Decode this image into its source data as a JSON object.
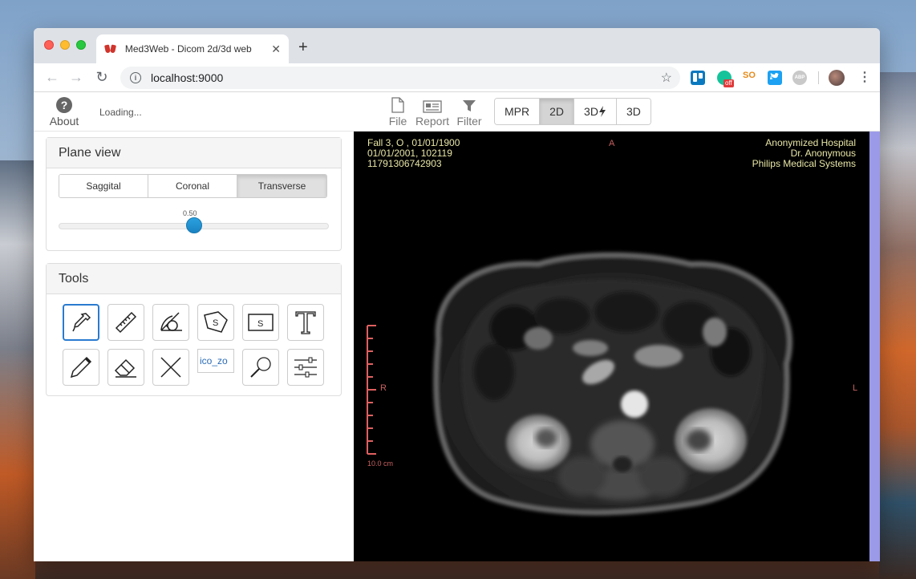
{
  "browser": {
    "tab_title": "Med3Web - Dicom 2d/3d web",
    "url": "localhost:9000",
    "extension_off_badge": "off",
    "extension_so": "SO",
    "extension_abp": "ABP"
  },
  "header": {
    "about_label": "About",
    "loading_text": "Loading...",
    "menu": {
      "file": "File",
      "report": "Report",
      "filter": "Filter"
    },
    "view_modes": [
      "MPR",
      "2D",
      "3D",
      "3D"
    ],
    "active_view": "2D"
  },
  "plane_view": {
    "title": "Plane view",
    "buttons": [
      "Saggital",
      "Coronal",
      "Transverse"
    ],
    "active": "Transverse",
    "slider_value": "0.50",
    "slider_fraction": 0.5
  },
  "tools": {
    "title": "Tools",
    "items": [
      {
        "name": "pipette-icon",
        "active": true
      },
      {
        "name": "ruler-icon"
      },
      {
        "name": "protractor-icon"
      },
      {
        "name": "area-polygon-icon",
        "text": "S"
      },
      {
        "name": "area-rect-icon",
        "text": "S"
      },
      {
        "name": "text-icon"
      },
      {
        "name": "pencil-icon"
      },
      {
        "name": "eraser-icon"
      },
      {
        "name": "clear-icon"
      },
      {
        "name": "zoom-icon",
        "alt": "ico_zoom"
      },
      {
        "name": "magnifier-icon"
      },
      {
        "name": "settings-sliders-icon"
      }
    ],
    "broken_image_text": "ico_zo"
  },
  "viewer": {
    "info_left": [
      "Fall 3, O , 01/01/1900",
      "01/01/2001, 102119",
      "11791306742903"
    ],
    "info_right": [
      "Anonymized Hospital",
      "Dr. Anonymous",
      "Philips Medical Systems"
    ],
    "orientation": {
      "top": "A",
      "left": "R",
      "right": "L"
    },
    "scale_label": "10.0 cm"
  }
}
